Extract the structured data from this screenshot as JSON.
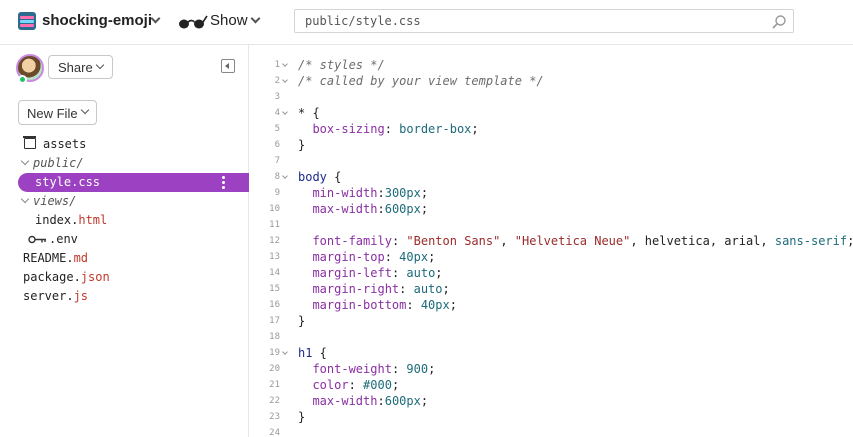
{
  "header": {
    "project_name": "shocking-emoji",
    "show_label": "Show",
    "search_value": "public/style.css"
  },
  "sidebar": {
    "share_label": "Share",
    "new_file_label": "New File",
    "files": [
      {
        "name": "assets",
        "kind": "assets"
      },
      {
        "name": "public/",
        "kind": "folder"
      },
      {
        "name": "style.css",
        "kind": "file",
        "selected": true
      },
      {
        "name": "views/",
        "kind": "folder"
      },
      {
        "name": "index.html",
        "base": "index.",
        "ext": "html",
        "kind": "file"
      },
      {
        "name": ".env",
        "kind": "env"
      },
      {
        "name": "README.md",
        "base": "README.",
        "ext": "md",
        "kind": "file"
      },
      {
        "name": "package.json",
        "base": "package.",
        "ext": "json",
        "kind": "file"
      },
      {
        "name": "server.js",
        "base": "server.",
        "ext": "js",
        "kind": "file"
      }
    ]
  },
  "editor": {
    "lines": [
      {
        "n": "1",
        "fold": true,
        "parts": [
          {
            "t": "/* styles */",
            "c": "c-comment"
          }
        ]
      },
      {
        "n": "2",
        "fold": true,
        "parts": [
          {
            "t": "/* called by your view template */",
            "c": "c-comment"
          }
        ]
      },
      {
        "n": "3",
        "parts": []
      },
      {
        "n": "4",
        "fold": true,
        "parts": [
          {
            "t": "* {",
            "c": ""
          }
        ]
      },
      {
        "n": "5",
        "parts": [
          {
            "t": "  ",
            "c": ""
          },
          {
            "t": "box-sizing",
            "c": "c-prop"
          },
          {
            "t": ": ",
            "c": ""
          },
          {
            "t": "border-box",
            "c": "c-val"
          },
          {
            "t": ";",
            "c": ""
          }
        ]
      },
      {
        "n": "6",
        "parts": [
          {
            "t": "}",
            "c": ""
          }
        ]
      },
      {
        "n": "7",
        "parts": []
      },
      {
        "n": "8",
        "fold": true,
        "parts": [
          {
            "t": "body",
            "c": "c-sel"
          },
          {
            "t": " {",
            "c": ""
          }
        ]
      },
      {
        "n": "9",
        "parts": [
          {
            "t": "  ",
            "c": ""
          },
          {
            "t": "min-width",
            "c": "c-prop"
          },
          {
            "t": ":",
            "c": ""
          },
          {
            "t": "300px",
            "c": "c-num"
          },
          {
            "t": ";",
            "c": ""
          }
        ]
      },
      {
        "n": "10",
        "parts": [
          {
            "t": "  ",
            "c": ""
          },
          {
            "t": "max-width",
            "c": "c-prop"
          },
          {
            "t": ":",
            "c": ""
          },
          {
            "t": "600px",
            "c": "c-num"
          },
          {
            "t": ";",
            "c": ""
          }
        ]
      },
      {
        "n": "11",
        "parts": []
      },
      {
        "n": "12",
        "parts": [
          {
            "t": "  ",
            "c": ""
          },
          {
            "t": "font-family",
            "c": "c-prop"
          },
          {
            "t": ": ",
            "c": ""
          },
          {
            "t": "\"Benton Sans\"",
            "c": "c-str"
          },
          {
            "t": ", ",
            "c": ""
          },
          {
            "t": "\"Helvetica Neue\"",
            "c": "c-str"
          },
          {
            "t": ", helvetica, arial, ",
            "c": ""
          },
          {
            "t": "sans-serif",
            "c": "c-val"
          },
          {
            "t": ";",
            "c": ""
          }
        ]
      },
      {
        "n": "13",
        "parts": [
          {
            "t": "  ",
            "c": ""
          },
          {
            "t": "margin-top",
            "c": "c-prop"
          },
          {
            "t": ": ",
            "c": ""
          },
          {
            "t": "40px",
            "c": "c-num"
          },
          {
            "t": ";",
            "c": ""
          }
        ]
      },
      {
        "n": "14",
        "parts": [
          {
            "t": "  ",
            "c": ""
          },
          {
            "t": "margin-left",
            "c": "c-prop"
          },
          {
            "t": ": ",
            "c": ""
          },
          {
            "t": "auto",
            "c": "c-val"
          },
          {
            "t": ";",
            "c": ""
          }
        ]
      },
      {
        "n": "15",
        "parts": [
          {
            "t": "  ",
            "c": ""
          },
          {
            "t": "margin-right",
            "c": "c-prop"
          },
          {
            "t": ": ",
            "c": ""
          },
          {
            "t": "auto",
            "c": "c-val"
          },
          {
            "t": ";",
            "c": ""
          }
        ]
      },
      {
        "n": "16",
        "parts": [
          {
            "t": "  ",
            "c": ""
          },
          {
            "t": "margin-bottom",
            "c": "c-prop"
          },
          {
            "t": ": ",
            "c": ""
          },
          {
            "t": "40px",
            "c": "c-num"
          },
          {
            "t": ";",
            "c": ""
          }
        ]
      },
      {
        "n": "17",
        "parts": [
          {
            "t": "}",
            "c": ""
          }
        ]
      },
      {
        "n": "18",
        "parts": []
      },
      {
        "n": "19",
        "fold": true,
        "parts": [
          {
            "t": "h1",
            "c": "c-sel"
          },
          {
            "t": " {",
            "c": ""
          }
        ]
      },
      {
        "n": "20",
        "parts": [
          {
            "t": "  ",
            "c": ""
          },
          {
            "t": "font-weight",
            "c": "c-prop"
          },
          {
            "t": ": ",
            "c": ""
          },
          {
            "t": "900",
            "c": "c-num"
          },
          {
            "t": ";",
            "c": ""
          }
        ]
      },
      {
        "n": "21",
        "parts": [
          {
            "t": "  ",
            "c": ""
          },
          {
            "t": "color",
            "c": "c-prop"
          },
          {
            "t": ": ",
            "c": ""
          },
          {
            "t": "#000",
            "c": "c-num"
          },
          {
            "t": ";",
            "c": ""
          }
        ]
      },
      {
        "n": "22",
        "parts": [
          {
            "t": "  ",
            "c": ""
          },
          {
            "t": "max-width",
            "c": "c-prop"
          },
          {
            "t": ":",
            "c": ""
          },
          {
            "t": "600px",
            "c": "c-num"
          },
          {
            "t": ";",
            "c": ""
          }
        ]
      },
      {
        "n": "23",
        "parts": [
          {
            "t": "}",
            "c": ""
          }
        ]
      },
      {
        "n": "24",
        "parts": []
      }
    ]
  },
  "colors": {
    "accent": "#9b41c1",
    "status_online": "#1fc160"
  }
}
